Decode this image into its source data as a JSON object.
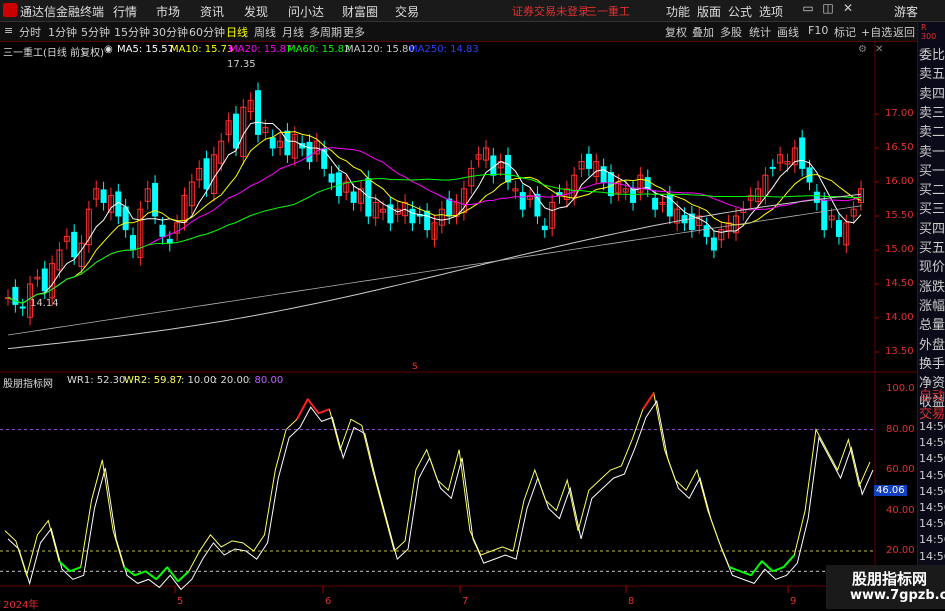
{
  "app": {
    "title": "通达信金融终端"
  },
  "menu": [
    "行情",
    "市场",
    "资讯",
    "发现",
    "问小达",
    "财富圈",
    "交易"
  ],
  "status": {
    "broker_msg": "证券交易未登录",
    "stock": "三一重工"
  },
  "top_right": [
    "功能",
    "版面",
    "公式",
    "选项"
  ],
  "guest": "游客",
  "periods": [
    "分时",
    "1分钟",
    "5分钟",
    "15分钟",
    "30分钟",
    "60分钟",
    "日线",
    "周线",
    "月线",
    "多周期",
    "更多"
  ],
  "active_period": "日线",
  "tools": [
    "复权",
    "叠加",
    "多股",
    "统计",
    "画线",
    "F10",
    "标记",
    "+自选",
    "返回"
  ],
  "main_indicator": {
    "name": "三一重工(日线 前复权)",
    "ma5": "MA5: 15.57",
    "ma10": "MA10: 15.73",
    "ma20": "MA20: 15.87",
    "ma60": "MA60: 15.82",
    "ma120": "MA120: 15.80",
    "ma250": "MA250: 14.83",
    "high_mark": "17.35",
    "low_mark": "14.14",
    "s_mark": "S"
  },
  "sub_indicator": {
    "name": "股朋指标网",
    "wr1": "WR1: 52.30",
    "wr2": "WR2: 59.87",
    "p1": ": 10.00",
    "p2": ": 20.00",
    "p3": ": 80.00",
    "value_box": "46.06"
  },
  "price_axis": [
    "17.00",
    "16.50",
    "16.00",
    "15.50",
    "15.00",
    "14.50",
    "14.00",
    "13.50"
  ],
  "wr_axis": [
    "100.0",
    "80.00",
    "60.00",
    "40.00",
    "20.00"
  ],
  "date_axis": [
    "2024年",
    "5",
    "6",
    "7",
    "8",
    "9"
  ],
  "right_labels": [
    "委比",
    "卖五",
    "卖四",
    "卖三",
    "卖二",
    "卖一",
    "买一",
    "买二",
    "买三",
    "买四",
    "买五",
    "现价",
    "涨跌",
    "涨幅",
    "总量",
    "外盘",
    "换手",
    "净资",
    "收益",
    "自动",
    "交易",
    "14:56",
    "14:56",
    "14:56",
    "14:56",
    "14:56",
    "14:56",
    "14:56",
    "14:56",
    "14:56",
    "14:56"
  ],
  "watermark": {
    "line1": "股朋指标网",
    "line2": "www.7gpzb.com"
  },
  "colors": {
    "up": "#ff3030",
    "down": "#00ffff",
    "ma5": "#ffffff",
    "ma10": "#ffff00",
    "ma20": "#ff00ff",
    "ma60": "#00ff00",
    "ma120": "#cccccc",
    "ma250": "#3040ff"
  }
}
